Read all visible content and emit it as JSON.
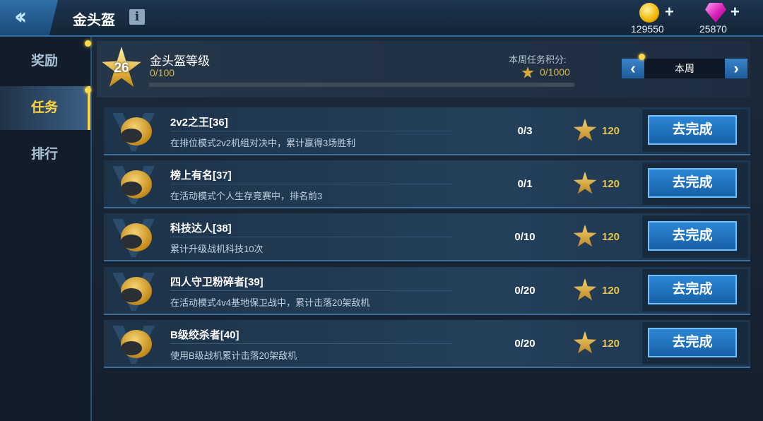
{
  "header": {
    "title": "金头盔",
    "back_icon": "double-chevron-left-icon",
    "info_icon": "info-icon"
  },
  "currency": {
    "coins": "129550",
    "gems": "25870",
    "coin_color": "#f0b400",
    "gem_color": "#d81fb9"
  },
  "sidebar": {
    "items": [
      {
        "label": "奖励",
        "active": false,
        "dot": true
      },
      {
        "label": "任务",
        "active": true,
        "dot": true
      },
      {
        "label": "排行",
        "active": false,
        "dot": false
      }
    ]
  },
  "rank": {
    "level": "26",
    "title": "金头盔等级",
    "progress_text": "0/100",
    "progress_fraction": 0
  },
  "weekly": {
    "label": "本周任务积分:",
    "score_text": "0/1000",
    "selector": "本周"
  },
  "tasks": [
    {
      "name": "2v2之王[36]",
      "desc": "在排位模式2v2机组对决中，累计赢得3场胜利",
      "progress": "0/3",
      "reward": "120",
      "button": "去完成"
    },
    {
      "name": "榜上有名[37]",
      "desc": "在活动模式个人生存竞赛中，排名前3",
      "progress": "0/1",
      "reward": "120",
      "button": "去完成"
    },
    {
      "name": "科技达人[38]",
      "desc": "累计升级战机科技10次",
      "progress": "0/10",
      "reward": "120",
      "button": "去完成"
    },
    {
      "name": "四人守卫粉碎者[39]",
      "desc": "在活动模式4v4基地保卫战中，累计击落20架敌机",
      "progress": "0/20",
      "reward": "120",
      "button": "去完成"
    },
    {
      "name": "B级绞杀者[40]",
      "desc": "使用B级战机累计击落20架敌机",
      "progress": "0/20",
      "reward": "120",
      "button": "去完成"
    }
  ]
}
